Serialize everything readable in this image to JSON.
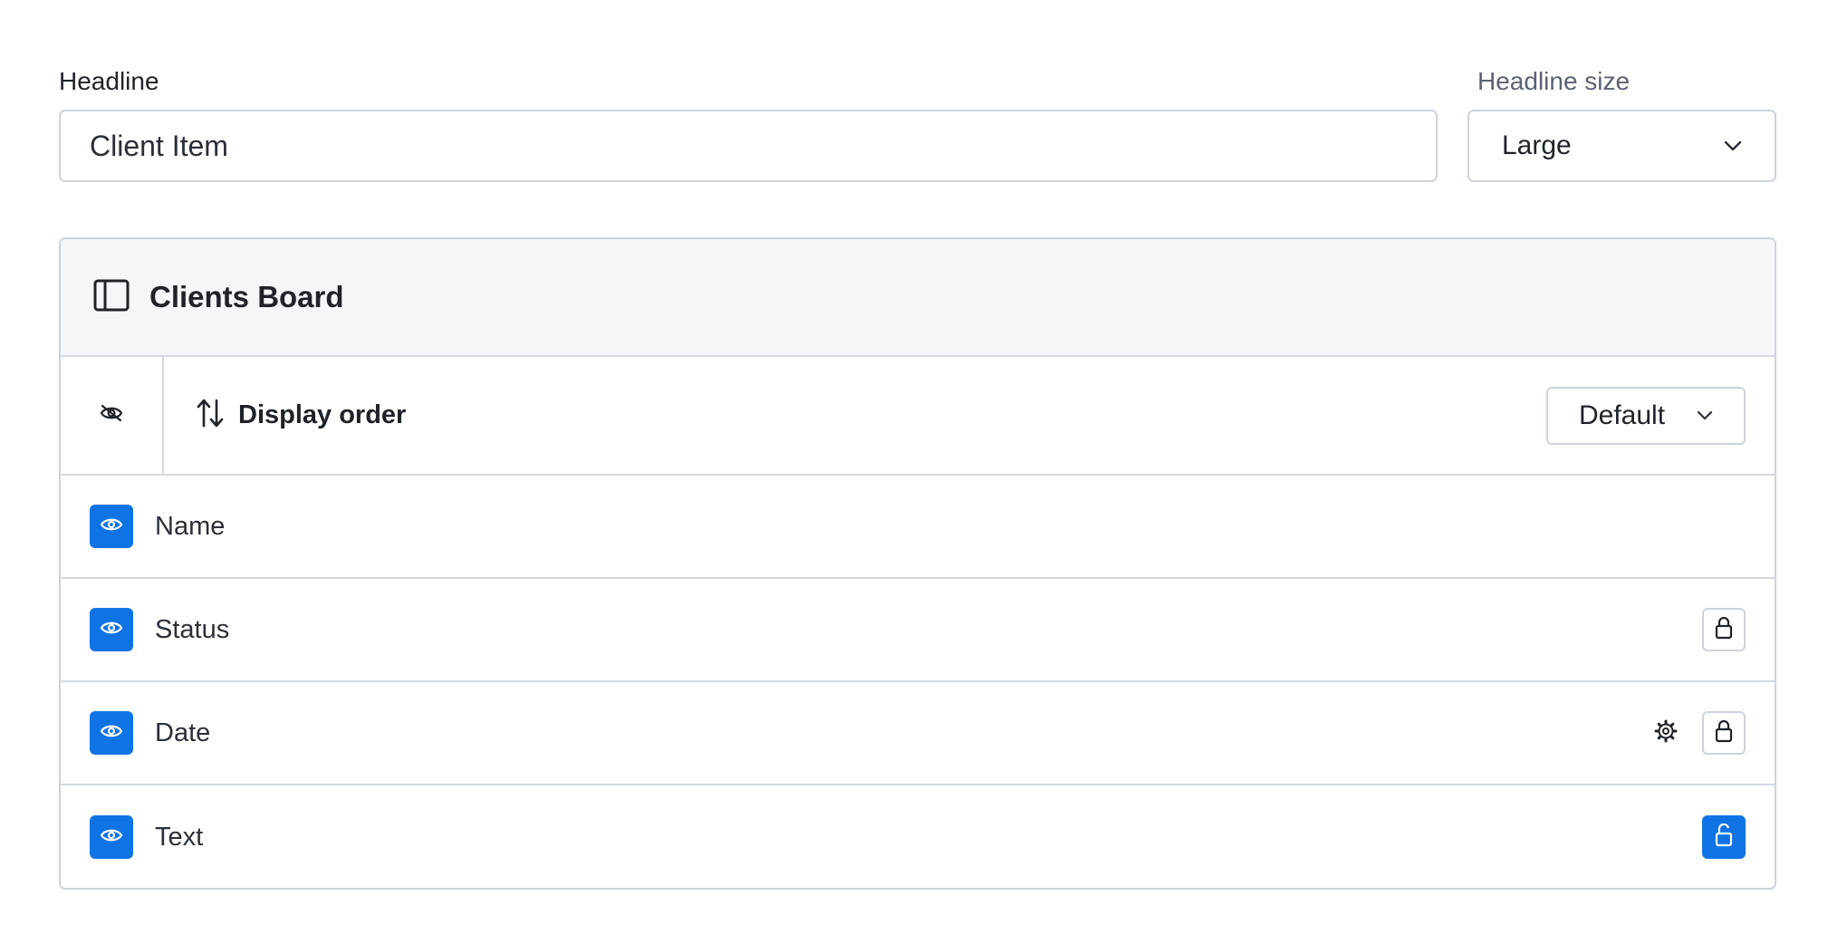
{
  "headline": {
    "label": "Headline",
    "value": "Client Item"
  },
  "headline_size": {
    "label": "Headline size",
    "selected": "Large"
  },
  "board": {
    "title": "Clients Board",
    "icon": "sidebar-panel-icon",
    "display_order": {
      "label": "Display order",
      "selected": "Default"
    },
    "fields": [
      {
        "name": "Name",
        "visible": true,
        "lock": null,
        "settings": false
      },
      {
        "name": "Status",
        "visible": true,
        "lock": "locked",
        "settings": false
      },
      {
        "name": "Date",
        "visible": true,
        "lock": "locked",
        "settings": true
      },
      {
        "name": "Text",
        "visible": true,
        "lock": "unlocked",
        "settings": false
      }
    ]
  },
  "colors": {
    "accent": "#0f73e6",
    "border": "#cdd3dd",
    "header_bg": "#f4f6fa"
  }
}
